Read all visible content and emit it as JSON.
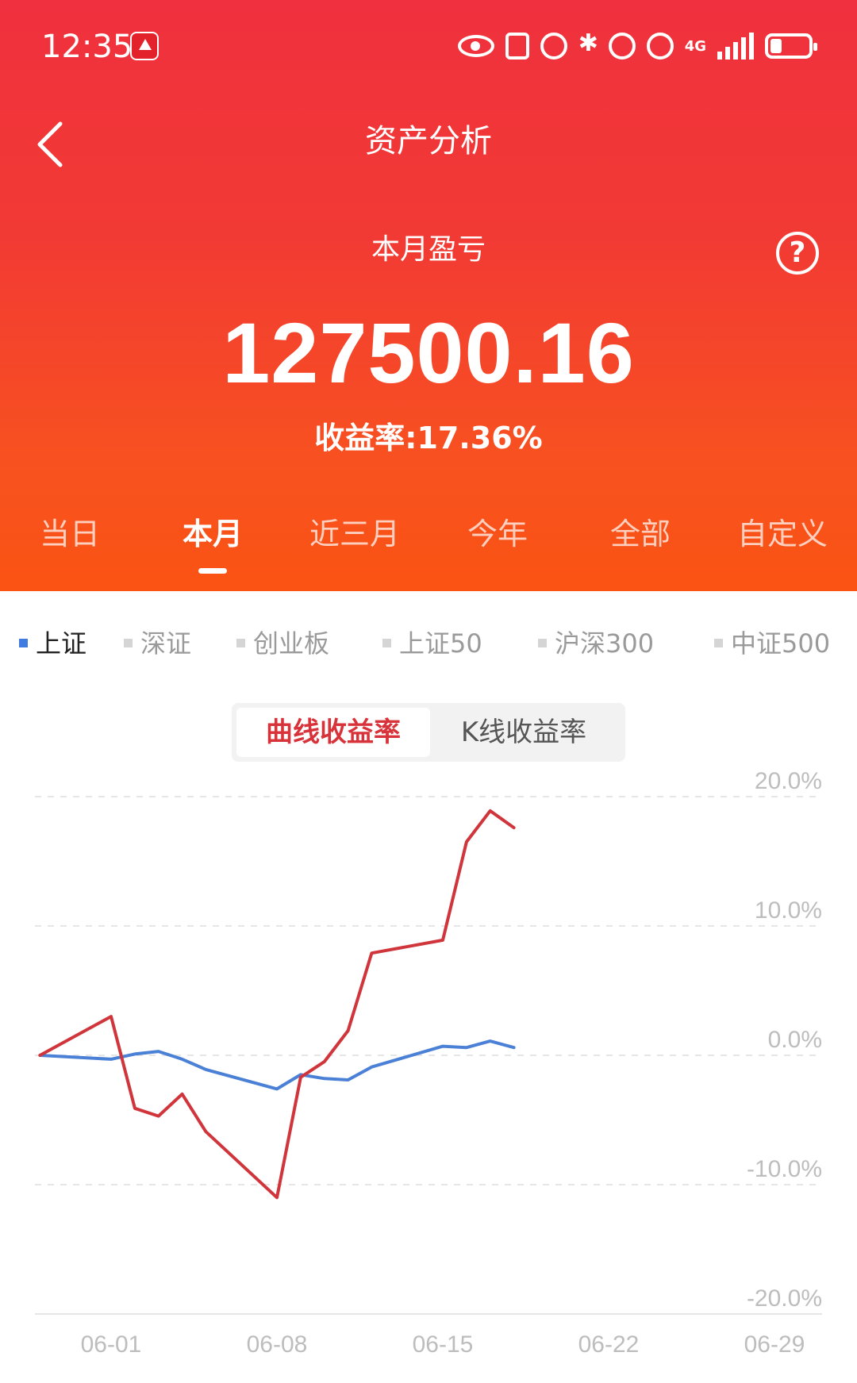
{
  "status_bar": {
    "time": "12:35",
    "network": "4G",
    "icons": [
      "app-badge-icon",
      "eye-icon",
      "nfc-icon",
      "alarm-icon",
      "bluetooth-icon",
      "mute-icon",
      "hotspot-icon",
      "signal-icon",
      "battery-icon"
    ]
  },
  "header": {
    "title": "资产分析",
    "back_icon": "chevron-left-icon",
    "help_icon": "question-circle-icon"
  },
  "summary": {
    "label": "本月盈亏",
    "value": "127500.16",
    "rate_label": "收益率:",
    "rate_value": "17.36%"
  },
  "period_tabs": [
    {
      "label": "当日",
      "active": false
    },
    {
      "label": "本月",
      "active": true
    },
    {
      "label": "近三月",
      "active": false
    },
    {
      "label": "今年",
      "active": false
    },
    {
      "label": "全部",
      "active": false
    },
    {
      "label": "自定义",
      "active": false
    }
  ],
  "index_tabs": [
    {
      "label": "上证",
      "active": true
    },
    {
      "label": "深证",
      "active": false
    },
    {
      "label": "创业板",
      "active": false
    },
    {
      "label": "上证50",
      "active": false
    },
    {
      "label": "沪深300",
      "active": false
    },
    {
      "label": "中证500",
      "active": false
    }
  ],
  "chart_mode": {
    "active": "曲线收益率",
    "inactive": "K线收益率"
  },
  "colors": {
    "header_top": "#f0303e",
    "header_bottom": "#fa5313",
    "portfolio_line": "#d0353b",
    "index_line": "#4a80d6",
    "active_index_dot": "#3f7be0"
  },
  "chart_data": {
    "type": "line",
    "x_ticks": [
      "06-01",
      "06-08",
      "06-15",
      "06-22",
      "06-29"
    ],
    "y_ticks": [
      "20.0%",
      "10.0%",
      "0.0%",
      "-10.0%",
      "-20.0%"
    ],
    "ylim": [
      -20,
      20
    ],
    "grid": true,
    "series": [
      {
        "color": "#d0353b",
        "points": [
          [
            "05-29",
            0.0
          ],
          [
            "06-01",
            3.0
          ],
          [
            "06-02",
            -4.1
          ],
          [
            "06-03",
            -4.7
          ],
          [
            "06-04",
            -3.0
          ],
          [
            "06-05",
            -5.9
          ],
          [
            "06-08",
            -11.0
          ],
          [
            "06-09",
            -1.7
          ],
          [
            "06-10",
            -0.5
          ],
          [
            "06-11",
            1.9
          ],
          [
            "06-12",
            7.9
          ],
          [
            "06-15",
            8.9
          ],
          [
            "06-16",
            16.5
          ],
          [
            "06-17",
            18.9
          ],
          [
            "06-18",
            17.6
          ]
        ]
      },
      {
        "color": "#4a80d6",
        "points": [
          [
            "05-29",
            0.0
          ],
          [
            "06-01",
            -0.3
          ],
          [
            "06-02",
            0.1
          ],
          [
            "06-03",
            0.3
          ],
          [
            "06-04",
            -0.3
          ],
          [
            "06-05",
            -1.1
          ],
          [
            "06-08",
            -2.6
          ],
          [
            "06-09",
            -1.5
          ],
          [
            "06-10",
            -1.8
          ],
          [
            "06-11",
            -1.9
          ],
          [
            "06-12",
            -0.9
          ],
          [
            "06-15",
            0.7
          ],
          [
            "06-16",
            0.6
          ],
          [
            "06-17",
            1.1
          ],
          [
            "06-18",
            0.6
          ]
        ]
      }
    ]
  }
}
